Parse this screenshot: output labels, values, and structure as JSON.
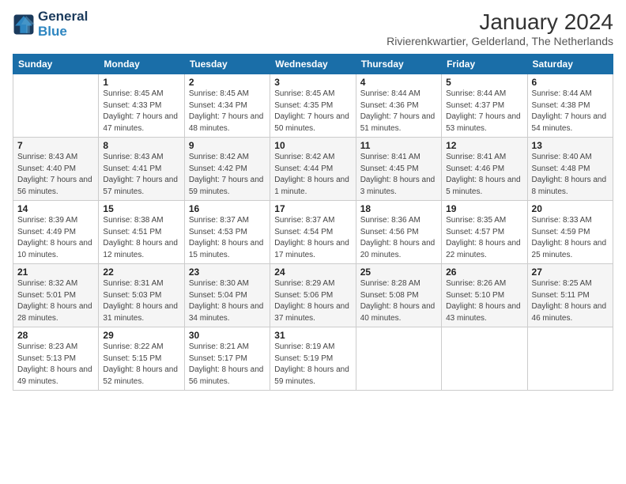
{
  "logo": {
    "line1": "General",
    "line2": "Blue"
  },
  "title": "January 2024",
  "subtitle": "Rivierenkwartier, Gelderland, The Netherlands",
  "days_of_week": [
    "Sunday",
    "Monday",
    "Tuesday",
    "Wednesday",
    "Thursday",
    "Friday",
    "Saturday"
  ],
  "weeks": [
    [
      {
        "day": "",
        "sunrise": "",
        "sunset": "",
        "daylight": ""
      },
      {
        "day": "1",
        "sunrise": "Sunrise: 8:45 AM",
        "sunset": "Sunset: 4:33 PM",
        "daylight": "Daylight: 7 hours and 47 minutes."
      },
      {
        "day": "2",
        "sunrise": "Sunrise: 8:45 AM",
        "sunset": "Sunset: 4:34 PM",
        "daylight": "Daylight: 7 hours and 48 minutes."
      },
      {
        "day": "3",
        "sunrise": "Sunrise: 8:45 AM",
        "sunset": "Sunset: 4:35 PM",
        "daylight": "Daylight: 7 hours and 50 minutes."
      },
      {
        "day": "4",
        "sunrise": "Sunrise: 8:44 AM",
        "sunset": "Sunset: 4:36 PM",
        "daylight": "Daylight: 7 hours and 51 minutes."
      },
      {
        "day": "5",
        "sunrise": "Sunrise: 8:44 AM",
        "sunset": "Sunset: 4:37 PM",
        "daylight": "Daylight: 7 hours and 53 minutes."
      },
      {
        "day": "6",
        "sunrise": "Sunrise: 8:44 AM",
        "sunset": "Sunset: 4:38 PM",
        "daylight": "Daylight: 7 hours and 54 minutes."
      }
    ],
    [
      {
        "day": "7",
        "sunrise": "Sunrise: 8:43 AM",
        "sunset": "Sunset: 4:40 PM",
        "daylight": "Daylight: 7 hours and 56 minutes."
      },
      {
        "day": "8",
        "sunrise": "Sunrise: 8:43 AM",
        "sunset": "Sunset: 4:41 PM",
        "daylight": "Daylight: 7 hours and 57 minutes."
      },
      {
        "day": "9",
        "sunrise": "Sunrise: 8:42 AM",
        "sunset": "Sunset: 4:42 PM",
        "daylight": "Daylight: 7 hours and 59 minutes."
      },
      {
        "day": "10",
        "sunrise": "Sunrise: 8:42 AM",
        "sunset": "Sunset: 4:44 PM",
        "daylight": "Daylight: 8 hours and 1 minute."
      },
      {
        "day": "11",
        "sunrise": "Sunrise: 8:41 AM",
        "sunset": "Sunset: 4:45 PM",
        "daylight": "Daylight: 8 hours and 3 minutes."
      },
      {
        "day": "12",
        "sunrise": "Sunrise: 8:41 AM",
        "sunset": "Sunset: 4:46 PM",
        "daylight": "Daylight: 8 hours and 5 minutes."
      },
      {
        "day": "13",
        "sunrise": "Sunrise: 8:40 AM",
        "sunset": "Sunset: 4:48 PM",
        "daylight": "Daylight: 8 hours and 8 minutes."
      }
    ],
    [
      {
        "day": "14",
        "sunrise": "Sunrise: 8:39 AM",
        "sunset": "Sunset: 4:49 PM",
        "daylight": "Daylight: 8 hours and 10 minutes."
      },
      {
        "day": "15",
        "sunrise": "Sunrise: 8:38 AM",
        "sunset": "Sunset: 4:51 PM",
        "daylight": "Daylight: 8 hours and 12 minutes."
      },
      {
        "day": "16",
        "sunrise": "Sunrise: 8:37 AM",
        "sunset": "Sunset: 4:53 PM",
        "daylight": "Daylight: 8 hours and 15 minutes."
      },
      {
        "day": "17",
        "sunrise": "Sunrise: 8:37 AM",
        "sunset": "Sunset: 4:54 PM",
        "daylight": "Daylight: 8 hours and 17 minutes."
      },
      {
        "day": "18",
        "sunrise": "Sunrise: 8:36 AM",
        "sunset": "Sunset: 4:56 PM",
        "daylight": "Daylight: 8 hours and 20 minutes."
      },
      {
        "day": "19",
        "sunrise": "Sunrise: 8:35 AM",
        "sunset": "Sunset: 4:57 PM",
        "daylight": "Daylight: 8 hours and 22 minutes."
      },
      {
        "day": "20",
        "sunrise": "Sunrise: 8:33 AM",
        "sunset": "Sunset: 4:59 PM",
        "daylight": "Daylight: 8 hours and 25 minutes."
      }
    ],
    [
      {
        "day": "21",
        "sunrise": "Sunrise: 8:32 AM",
        "sunset": "Sunset: 5:01 PM",
        "daylight": "Daylight: 8 hours and 28 minutes."
      },
      {
        "day": "22",
        "sunrise": "Sunrise: 8:31 AM",
        "sunset": "Sunset: 5:03 PM",
        "daylight": "Daylight: 8 hours and 31 minutes."
      },
      {
        "day": "23",
        "sunrise": "Sunrise: 8:30 AM",
        "sunset": "Sunset: 5:04 PM",
        "daylight": "Daylight: 8 hours and 34 minutes."
      },
      {
        "day": "24",
        "sunrise": "Sunrise: 8:29 AM",
        "sunset": "Sunset: 5:06 PM",
        "daylight": "Daylight: 8 hours and 37 minutes."
      },
      {
        "day": "25",
        "sunrise": "Sunrise: 8:28 AM",
        "sunset": "Sunset: 5:08 PM",
        "daylight": "Daylight: 8 hours and 40 minutes."
      },
      {
        "day": "26",
        "sunrise": "Sunrise: 8:26 AM",
        "sunset": "Sunset: 5:10 PM",
        "daylight": "Daylight: 8 hours and 43 minutes."
      },
      {
        "day": "27",
        "sunrise": "Sunrise: 8:25 AM",
        "sunset": "Sunset: 5:11 PM",
        "daylight": "Daylight: 8 hours and 46 minutes."
      }
    ],
    [
      {
        "day": "28",
        "sunrise": "Sunrise: 8:23 AM",
        "sunset": "Sunset: 5:13 PM",
        "daylight": "Daylight: 8 hours and 49 minutes."
      },
      {
        "day": "29",
        "sunrise": "Sunrise: 8:22 AM",
        "sunset": "Sunset: 5:15 PM",
        "daylight": "Daylight: 8 hours and 52 minutes."
      },
      {
        "day": "30",
        "sunrise": "Sunrise: 8:21 AM",
        "sunset": "Sunset: 5:17 PM",
        "daylight": "Daylight: 8 hours and 56 minutes."
      },
      {
        "day": "31",
        "sunrise": "Sunrise: 8:19 AM",
        "sunset": "Sunset: 5:19 PM",
        "daylight": "Daylight: 8 hours and 59 minutes."
      },
      {
        "day": "",
        "sunrise": "",
        "sunset": "",
        "daylight": ""
      },
      {
        "day": "",
        "sunrise": "",
        "sunset": "",
        "daylight": ""
      },
      {
        "day": "",
        "sunrise": "",
        "sunset": "",
        "daylight": ""
      }
    ]
  ]
}
